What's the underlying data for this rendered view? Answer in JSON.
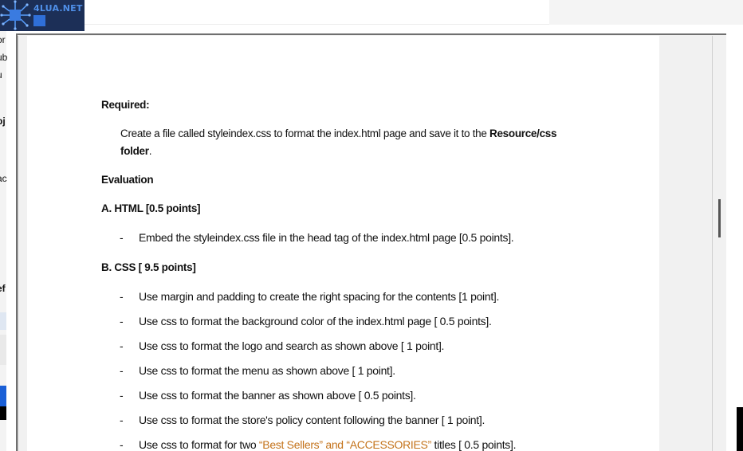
{
  "watermark": {
    "logo_text": "4LUA.NET",
    "colors": {
      "background": "#1c2f57",
      "text": "#4f8fe8",
      "accent": "#2f6fd8"
    }
  },
  "left_fragments": [
    {
      "text": "or",
      "bold": false
    },
    {
      "text": "ub",
      "bold": false
    },
    {
      "text": "u",
      "bold": false
    },
    {
      "text": "bj",
      "bold": true
    },
    {
      "text": "ac",
      "bold": false
    },
    {
      "text": "ef",
      "bold": true
    }
  ],
  "document": {
    "required_heading": "Required:",
    "required_text_before": "Create a file called styleindex.css to format the index.html page and save it to the ",
    "required_text_bold": "Resource/css folder",
    "required_text_after": ".",
    "evaluation_heading": "Evaluation",
    "section_a": {
      "title": "A. HTML  [0.5 points]",
      "items": [
        "Embed the styleindex.css file in the head tag of the index.html page [0.5 points]."
      ]
    },
    "section_b": {
      "title": "B. CSS  [ 9.5 points]",
      "items": [
        "Use margin and padding to create the right spacing for the contents [1 point].",
        "Use css to format the background color of the index.html page [ 0.5 points].",
        "Use css to format the logo and search as shown above [ 1 point].",
        "Use css to format the menu as shown above [ 1 point].",
        "Use css to format the banner as shown above [ 0.5 points].",
        "Use css to format the store's policy content following the banner [ 1 point]."
      ],
      "last_item": {
        "before": "Use css to format for two ",
        "accent": "“Best Sellers”  and “ACCESSORIES”",
        "after": "  titles [ 0.5 points]."
      },
      "accent_color": "#c4731b"
    },
    "bullet_dash": "-"
  }
}
